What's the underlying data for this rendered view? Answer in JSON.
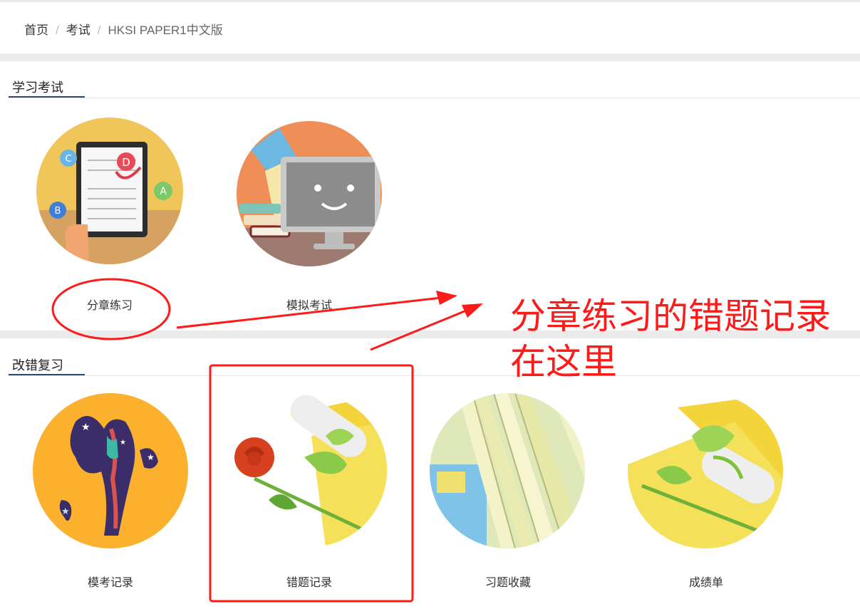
{
  "breadcrumb": {
    "items": [
      "首页",
      "考试"
    ],
    "current": "HKSI PAPER1中文版",
    "separator": "/"
  },
  "sections": {
    "study": {
      "title": "学习考试"
    },
    "review": {
      "title": "改错复习"
    }
  },
  "tiles": {
    "chapter_practice": {
      "label": "分章练习",
      "icon": "tablet-quiz-illustration"
    },
    "mock_exam": {
      "label": "模拟考试",
      "icon": "computer-screen-illustration"
    },
    "mock_records": {
      "label": "模考记录",
      "icon": "cosmic-figure-illustration"
    },
    "wrong_records": {
      "label": "错题记录",
      "icon": "rose-scroll-illustration"
    },
    "favorites": {
      "label": "习题收藏",
      "icon": "open-book-pages-illustration"
    },
    "transcript": {
      "label": "成绩单",
      "icon": "diploma-scroll-illustration"
    }
  },
  "annotation": {
    "line1": "分章练习的错题记录",
    "line2": "在这里",
    "color": "#ff1a1a"
  },
  "colors": {
    "accent_underline": "#2b4a6f",
    "divider_band": "#ebebeb"
  }
}
